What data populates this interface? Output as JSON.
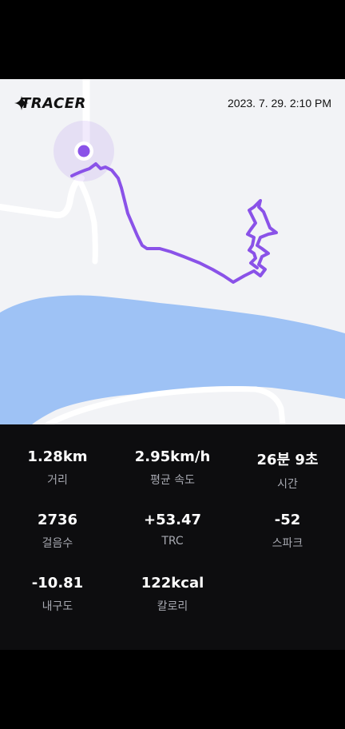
{
  "header": {
    "brand": "TRACER",
    "logo_icon": "sparkle-icon",
    "datetime": "2023. 7. 29. 2:10 PM"
  },
  "map": {
    "route_color": "#8a52e8",
    "water_color": "#9ec2f5",
    "land_color": "#f2f3f6",
    "road_color": "#ffffff",
    "start_marker_icon": "location-marker-icon"
  },
  "stats": [
    {
      "value": "1.28km",
      "label": "거리"
    },
    {
      "value": "2.95km/h",
      "label": "평균 속도"
    },
    {
      "value": "26분 9초",
      "label": "시간"
    },
    {
      "value": "2736",
      "label": "걸음수"
    },
    {
      "value": "+53.47",
      "label": "TRC"
    },
    {
      "value": "-52",
      "label": "스파크"
    },
    {
      "value": "-10.81",
      "label": "내구도"
    },
    {
      "value": "122kcal",
      "label": "칼로리"
    }
  ]
}
